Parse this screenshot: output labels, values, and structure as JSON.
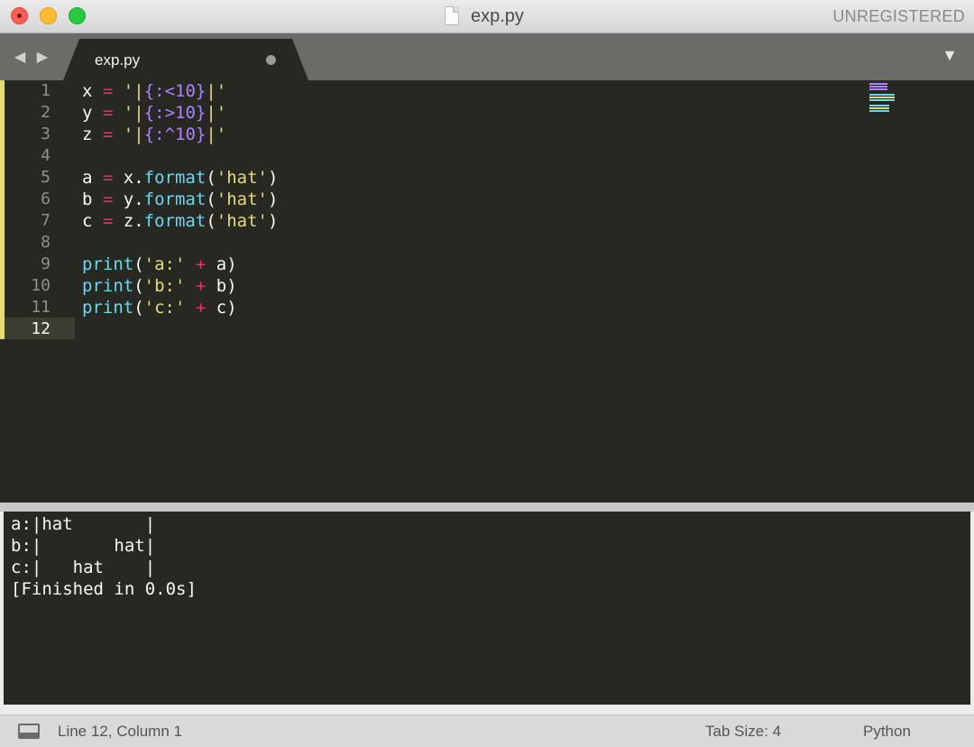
{
  "window": {
    "title": "exp.py",
    "registration": "UNREGISTERED"
  },
  "tabs": {
    "nav": "◀ ▶",
    "active_label": "exp.py",
    "menu_icon": "▼"
  },
  "editor": {
    "line_numbers": [
      "1",
      "2",
      "3",
      "4",
      "5",
      "6",
      "7",
      "8",
      "9",
      "10",
      "11",
      "12"
    ],
    "current_line": 12
  },
  "output": {
    "lines": [
      "a:|hat       |",
      "b:|       hat|",
      "c:|   hat    |",
      "[Finished in 0.0s]"
    ]
  },
  "status": {
    "position": "Line 12, Column 1",
    "tab_size": "Tab Size: 4",
    "syntax": "Python"
  },
  "colors": {
    "background": "#272822",
    "keyword": "#f92672",
    "string": "#e6db74",
    "function": "#66d9ef",
    "constant": "#ae81ff",
    "text": "#f8f8f2"
  }
}
